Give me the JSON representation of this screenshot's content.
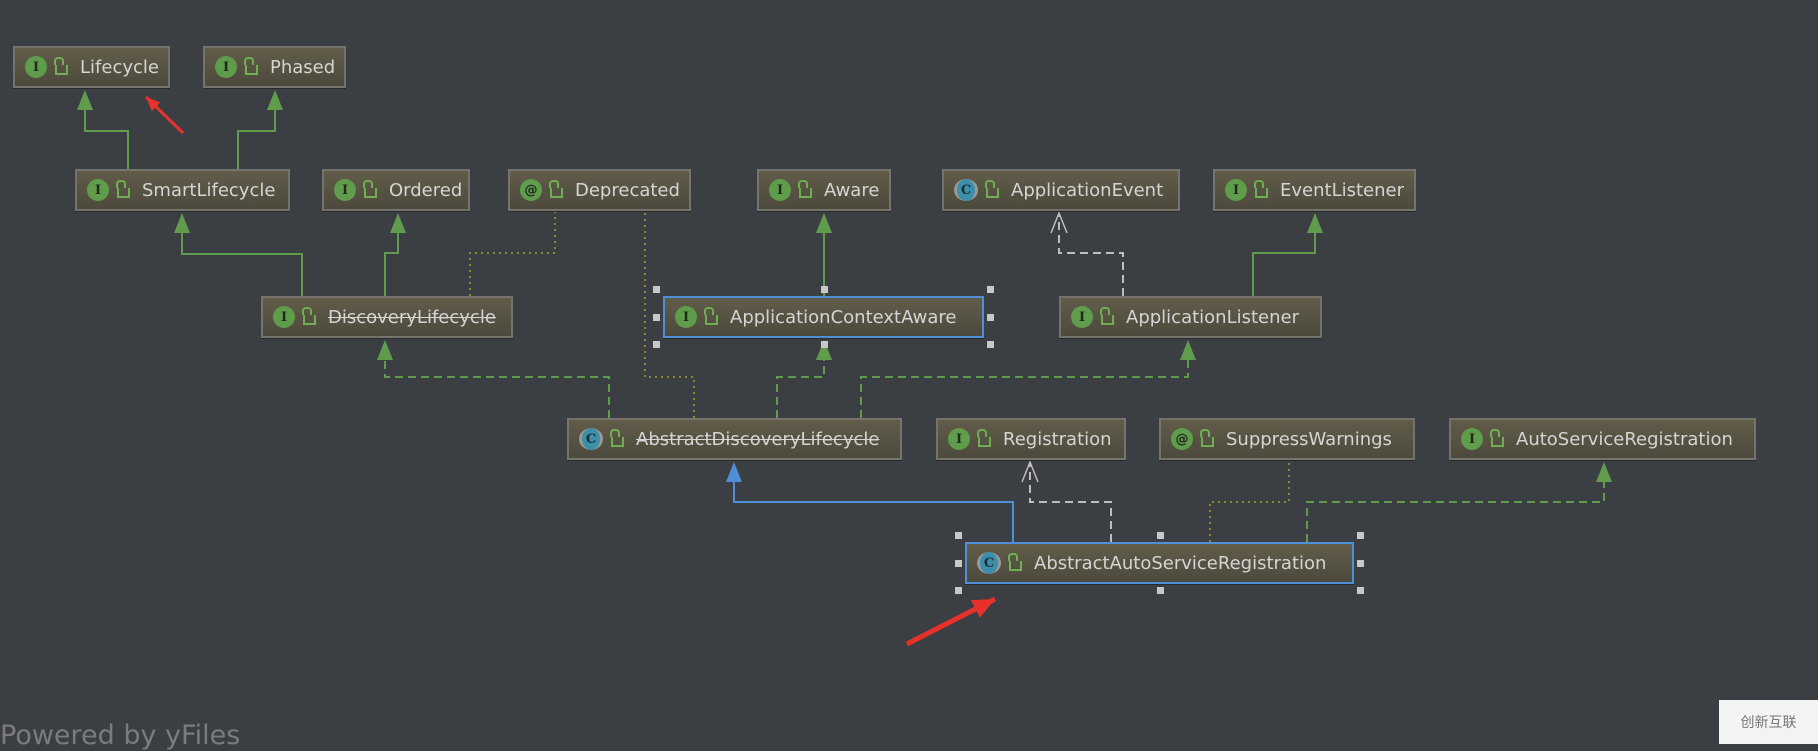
{
  "colors": {
    "background": "#3b3e42",
    "inheritance": "#5f9c4c",
    "selected": "#4f8fd8",
    "annotation_dotted": "#8a8a2a",
    "realization_gray": "#bdbdbd",
    "red_annotation": "#e8312a"
  },
  "nodes": [
    {
      "label": "Lifecycle",
      "kind": "I",
      "icon": "interface-icon"
    },
    {
      "label": "Phased",
      "kind": "I",
      "icon": "interface-icon"
    },
    {
      "label": "SmartLifecycle",
      "kind": "I",
      "icon": "interface-icon"
    },
    {
      "label": "Ordered",
      "kind": "I",
      "icon": "interface-icon"
    },
    {
      "label": "Deprecated",
      "kind": "@",
      "icon": "annotation-icon"
    },
    {
      "label": "Aware",
      "kind": "I",
      "icon": "interface-icon"
    },
    {
      "label": "ApplicationEvent",
      "kind": "C",
      "icon": "abstract-class-icon"
    },
    {
      "label": "EventListener",
      "kind": "I",
      "icon": "interface-icon"
    },
    {
      "label": "DiscoveryLifecycle",
      "kind": "I",
      "icon": "interface-icon",
      "deprecated": true
    },
    {
      "label": "ApplicationContextAware",
      "kind": "I",
      "icon": "interface-icon",
      "selected": true
    },
    {
      "label": "ApplicationListener",
      "kind": "I",
      "icon": "interface-icon"
    },
    {
      "label": "AbstractDiscoveryLifecycle",
      "kind": "C",
      "icon": "abstract-class-icon",
      "deprecated": true
    },
    {
      "label": "Registration",
      "kind": "I",
      "icon": "interface-icon"
    },
    {
      "label": "SuppressWarnings",
      "kind": "@",
      "icon": "annotation-icon"
    },
    {
      "label": "AutoServiceRegistration",
      "kind": "I",
      "icon": "interface-icon"
    },
    {
      "label": "AbstractAutoServiceRegistration",
      "kind": "C",
      "icon": "abstract-class-icon",
      "selected": true
    }
  ],
  "footer": {
    "powered_by": "Powered by yFiles"
  },
  "watermark": {
    "text": "创新互联"
  }
}
